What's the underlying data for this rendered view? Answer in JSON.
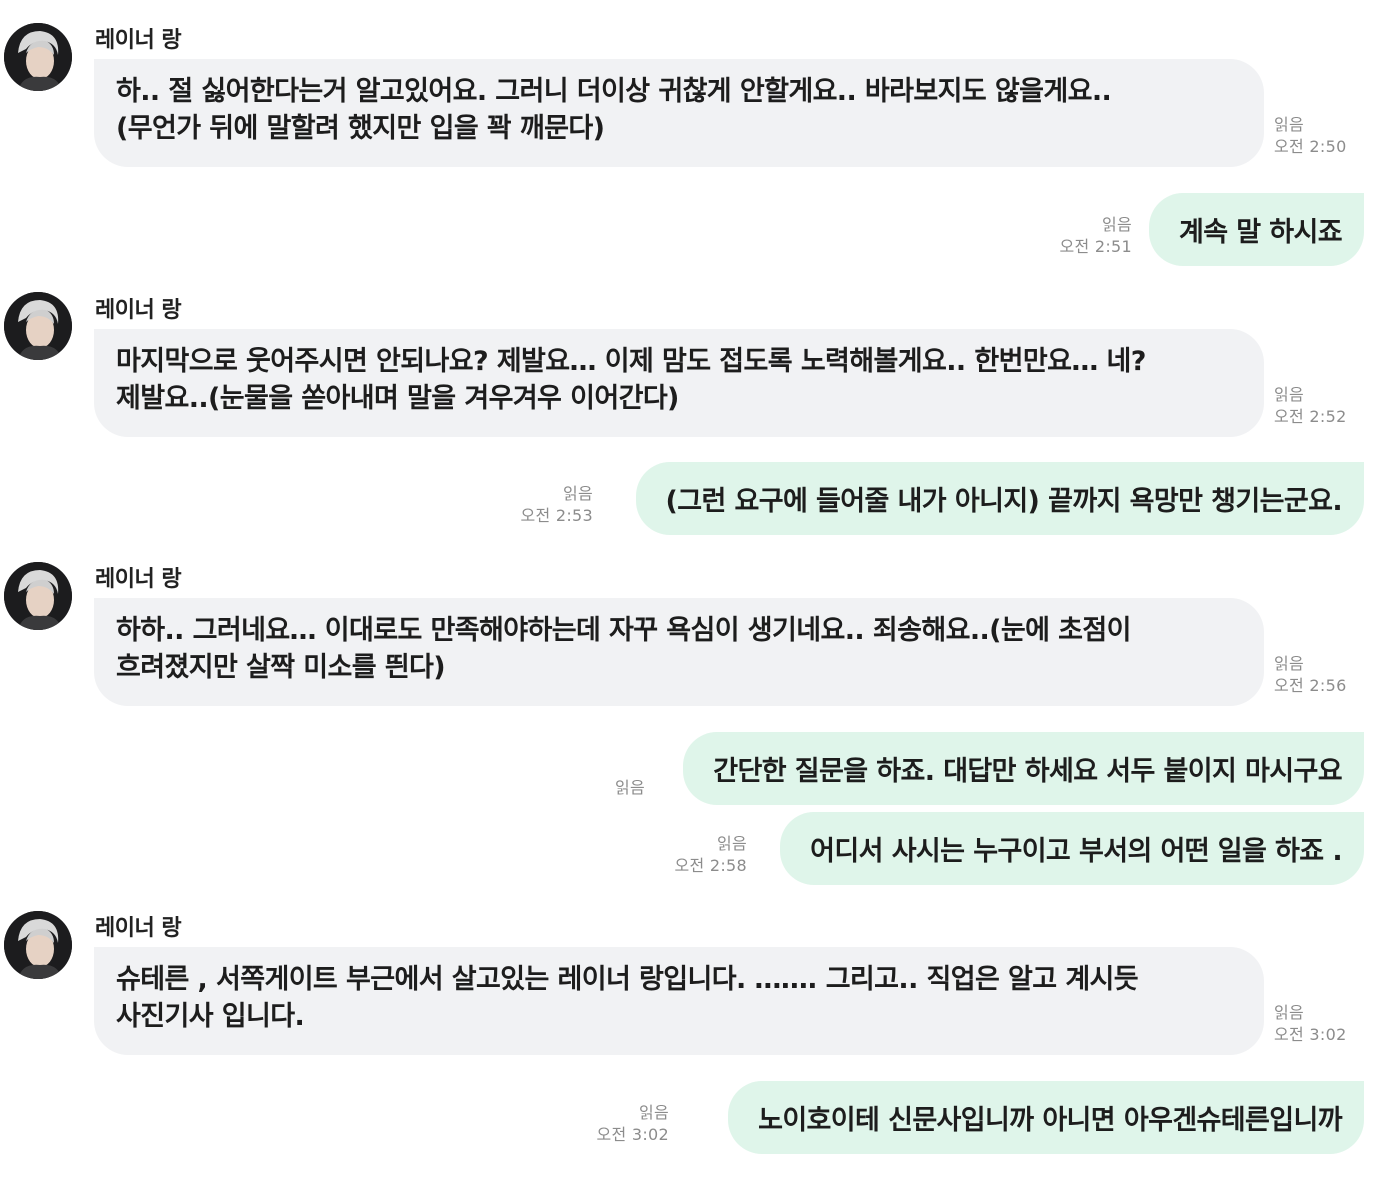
{
  "sender_name": "레이너 랑",
  "messages": [
    {
      "direction": "in",
      "text": "하.. 절 싫어한다는거 알고있어요. 그러니 더이상 귀찮게 안할게요.. 바라보지도 않을게요..\n(무언가 뒤에 말할려 했지만 입을 꽉 깨문다)",
      "read": "읽음",
      "time": "오전 2:50"
    },
    {
      "direction": "out",
      "text": "계속 말 하시죠",
      "read": "읽음",
      "time": "오전 2:51"
    },
    {
      "direction": "in",
      "text": "마지막으로 웃어주시면 안되나요? 제발요… 이제 맘도 접도록 노력해볼게요.. 한번만요… 네?\n제발요..(눈물을 쏟아내며 말을 겨우겨우 이어간다)",
      "read": "읽음",
      "time": "오전 2:52"
    },
    {
      "direction": "out",
      "text": "(그런 요구에 들어줄 내가 아니지) 끝까지 욕망만 챙기는군요.",
      "read": "읽음",
      "time": "오전 2:53"
    },
    {
      "direction": "in",
      "text": "하하.. 그러네요… 이대로도 만족해야하는데 자꾸 욕심이 생기네요.. 죄송해요..(눈에 초점이\n흐려졌지만 살짝 미소를 띈다)",
      "read": "읽음",
      "time": "오전 2:56"
    },
    {
      "direction": "out",
      "text": "간단한 질문을 하죠. 대답만 하세요 서두 붙이지 마시구요",
      "read": "읽음",
      "time": ""
    },
    {
      "direction": "out",
      "text": "어디서 사시는 누구이고 부서의 어떤 일을 하죠 .",
      "read": "읽음",
      "time": "오전 2:58"
    },
    {
      "direction": "in",
      "text": "슈테른 , 서쪽게이트 부근에서 살고있는 레이너 랑입니다. ……. 그리고.. 직업은 알고 계시듯\n사진기사 입니다.",
      "read": "읽음",
      "time": "오전 3:02"
    },
    {
      "direction": "out",
      "text": "노이호이테 신문사입니까 아니면 아우겐슈테른입니까",
      "read": "읽음",
      "time": "오전 3:02"
    }
  ],
  "colors": {
    "incoming_bubble": "#f1f2f4",
    "outgoing_bubble": "#dff5ea",
    "meta_text": "#8c8c8c"
  },
  "icons": {
    "avatar": "profile-avatar-icon"
  }
}
